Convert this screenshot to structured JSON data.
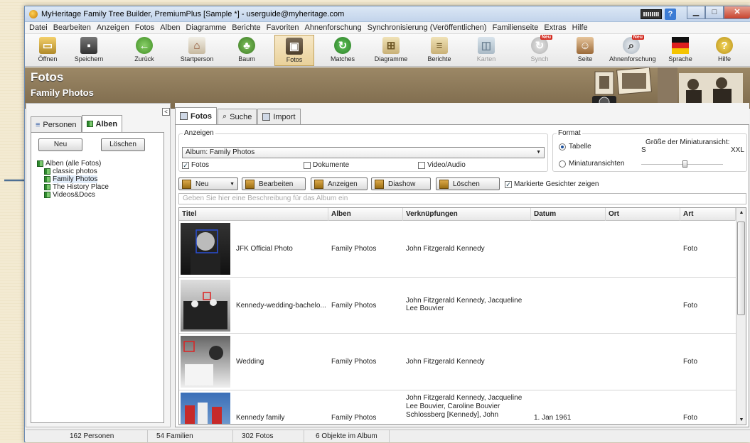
{
  "window": {
    "title": "MyHeritage Family Tree Builder, PremiumPlus [Sample *] - userguide@myheritage.com"
  },
  "menu": [
    "Datei",
    "Bearbeiten",
    "Anzeigen",
    "Fotos",
    "Alben",
    "Diagramme",
    "Berichte",
    "Favoriten",
    "Ahnenforschung",
    "Synchronisierung (Veröffentlichen)",
    "Familienseite",
    "Extras",
    "Hilfe"
  ],
  "toolbar": {
    "open": "Öffnen",
    "save": "Speichern",
    "back": "Zurück",
    "startperson": "Startperson",
    "tree": "Baum",
    "photos": "Fotos",
    "matches": "Matches",
    "charts": "Diagramme",
    "reports": "Berichte",
    "maps": "Karten",
    "sync": "Synch",
    "site": "Seite",
    "research": "Ahnenforschung",
    "language": "Sprache",
    "help": "Hilfe",
    "new_badge": "Neu"
  },
  "banner": {
    "title": "Fotos",
    "subtitle": "Family Photos"
  },
  "left": {
    "collapse": "<",
    "tab_persons": "Personen",
    "tab_albums": "Alben",
    "btn_new": "Neu",
    "btn_delete": "Löschen",
    "tree_root": "Alben (alle Fotos)",
    "albums": [
      "classic photos",
      "Family Photos",
      "The History Place",
      "Videos&Docs"
    ]
  },
  "right": {
    "tab_photos": "Fotos",
    "tab_search": "Suche",
    "tab_import": "Import",
    "show_label": "Anzeigen",
    "album_select": "Album: Family Photos",
    "chk_photos": "Fotos",
    "chk_docs": "Dokumente",
    "chk_video": "Video/Audio",
    "format_label": "Format",
    "radio_table": "Tabelle",
    "radio_thumbs": "Miniaturansichten",
    "thumb_size_label": "Größe der Miniaturansicht:",
    "size_s": "S",
    "size_xxl": "XXL",
    "btn_new": "Neu",
    "btn_edit": "Bearbeiten",
    "btn_show": "Anzeigen",
    "btn_slideshow": "Diashow",
    "btn_delete": "Löschen",
    "chk_faces": "Markierte Gesichter zeigen",
    "desc_placeholder": "Geben Sie hier eine Beschreibung für das Album ein"
  },
  "table": {
    "columns": [
      "Titel",
      "Alben",
      "Verknüpfungen",
      "Datum",
      "Ort",
      "Art"
    ],
    "rows": [
      {
        "title": "JFK Official Photo",
        "album": "Family Photos",
        "links": "John Fitzgerald Kennedy",
        "date": "",
        "place": "",
        "type": "Foto"
      },
      {
        "title": "Kennedy-wedding-bachelo...",
        "album": "Family Photos",
        "links": "John Fitzgerald Kennedy, Jacqueline Lee Bouvier",
        "date": "",
        "place": "",
        "type": "Foto"
      },
      {
        "title": "Wedding",
        "album": "Family Photos",
        "links": "John Fitzgerald Kennedy",
        "date": "",
        "place": "",
        "type": "Foto"
      },
      {
        "title": "Kennedy family",
        "album": "Family Photos",
        "links": "John Fitzgerald Kennedy, Jacqueline Lee Bouvier, Caroline Bouvier Schlossberg [Kennedy], John",
        "date": "1. Jan 1961",
        "place": "",
        "type": "Foto"
      }
    ]
  },
  "status": {
    "persons": "162 Personen",
    "families": "54 Familien",
    "photos": "302 Fotos",
    "album_items": "6 Objekte im Album"
  }
}
